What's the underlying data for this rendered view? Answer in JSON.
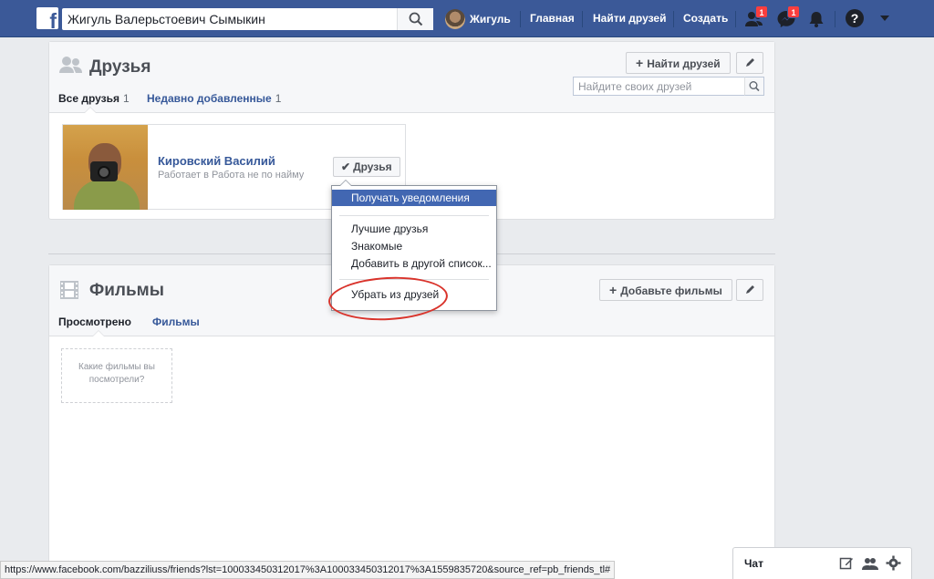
{
  "colors": {
    "topbar": "#3b5998",
    "link": "#365899",
    "highlight": "#4267b2",
    "badge": "#fa3e3e",
    "annotation": "#d9332b"
  },
  "header": {
    "search_value": "Жигуль Валерьстоевич Сымыкин",
    "user_name": "Жигуль",
    "nav": {
      "home": "Главная",
      "find_friends": "Найти друзей",
      "create": "Создать"
    },
    "friend_requests_badge": "1",
    "messages_badge": "1",
    "help_symbol": "?"
  },
  "friends_section": {
    "title": "Друзья",
    "find_friends_button": "Найти друзей",
    "tabs": [
      {
        "label": "Все друзья",
        "count": "1"
      },
      {
        "label": "Недавно добавленные",
        "count": "1"
      }
    ],
    "search_placeholder": "Найдите своих друзей",
    "friend": {
      "name": "Кировский Василий",
      "work": "Работает в Работа не по найму",
      "button": "Друзья"
    }
  },
  "dropdown": {
    "notifications": "Получать уведомления",
    "close_friends": "Лучшие друзья",
    "acquaintances": "Знакомые",
    "add_to_list": "Добавить в другой список...",
    "unfriend": "Убрать из друзей"
  },
  "movies_section": {
    "title": "Фильмы",
    "add_button": "Добавьте фильмы",
    "tabs": [
      "Просмотрено",
      "Фильмы"
    ],
    "empty_prompt": "Какие фильмы вы посмотрели?"
  },
  "status_url": "https://www.facebook.com/bazziliuss/friends?lst=100033450312017%3A100033450312017%3A1559835720&source_ref=pb_friends_tl#",
  "chat": {
    "label": "Чат"
  }
}
